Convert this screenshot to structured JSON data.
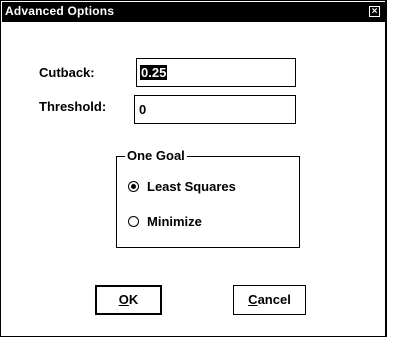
{
  "window": {
    "title": "Advanced Options",
    "close_glyph": "×"
  },
  "fields": {
    "cutback": {
      "label": "Cutback:",
      "value": "0.25"
    },
    "threshold": {
      "label": "Threshold:",
      "value": "0"
    }
  },
  "goal_group": {
    "legend": "One Goal",
    "options": [
      {
        "label": "Least Squares",
        "checked": true
      },
      {
        "label": "Minimize",
        "checked": false
      }
    ]
  },
  "buttons": {
    "ok": {
      "mnemonic": "O",
      "rest": "K"
    },
    "cancel": {
      "mnemonic": "C",
      "rest": "ancel"
    }
  }
}
